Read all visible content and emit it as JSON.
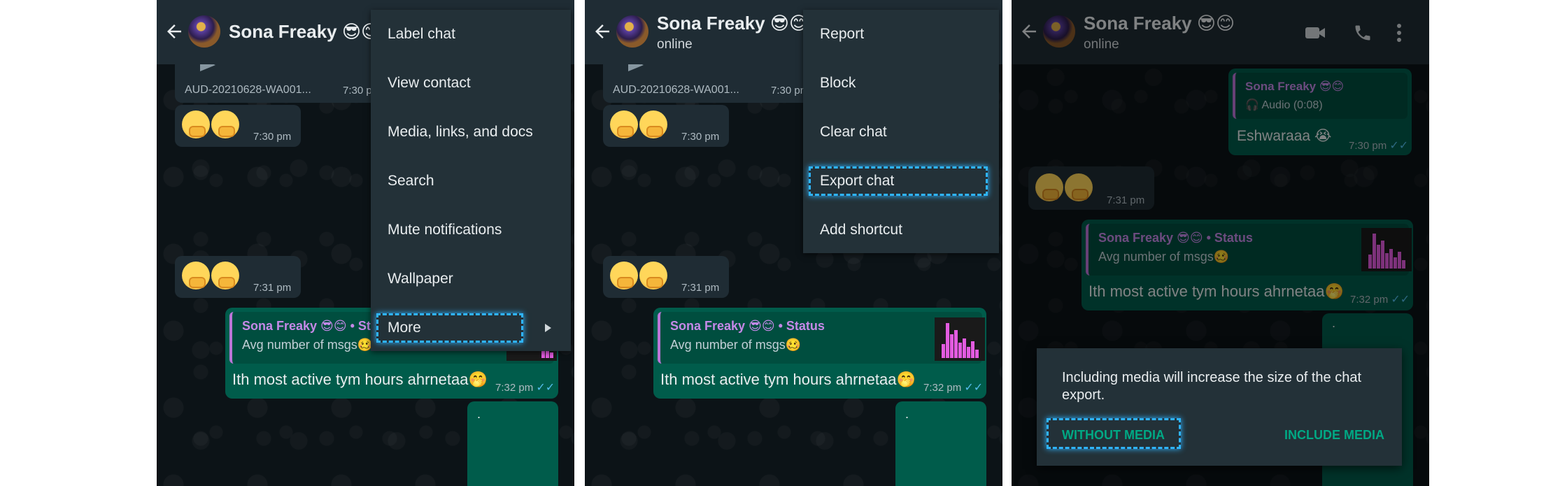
{
  "contact": {
    "name": "Sona Freaky 😎😊",
    "status": "online"
  },
  "messages": {
    "audio_file": "AUD-20210628-WA001...",
    "audio_time": "7:30 pm",
    "emoji1_time": "7:30 pm",
    "emoji2_time": "7:31 pm",
    "status_reply": {
      "name": "Sona Freaky 😎😊",
      "tag": " • Status",
      "sub": "Avg number of msgs🥴",
      "text": "Ith most active tym hours ahrnetaa🤭",
      "time": "7:32 pm"
    },
    "dot": "."
  },
  "panel3": {
    "quote_audio_name": "Sona Freaky 😎😊",
    "quote_audio_sub": "🎧 Audio (0:08)",
    "reply_text": "Eshwaraaa 😭",
    "reply_time": "7:30 pm",
    "emoji_time": "7:31 pm"
  },
  "menu1": {
    "items": [
      "Label chat",
      "View contact",
      "Media, links, and docs",
      "Search",
      "Mute notifications",
      "Wallpaper",
      "More"
    ],
    "highlighted": "More"
  },
  "menu2": {
    "items": [
      "Report",
      "Block",
      "Clear chat",
      "Export chat",
      "Add shortcut"
    ],
    "highlighted": "Export chat"
  },
  "dialog": {
    "text": "Including media will increase the size of the chat export.",
    "without_media": "WITHOUT MEDIA",
    "include_media": "INCLUDE MEDIA"
  },
  "icons": [
    "back-arrow-icon",
    "video-call-icon",
    "phone-icon",
    "more-vert-icon",
    "chevron-right-icon",
    "double-check-icon"
  ],
  "colors": {
    "header": "#1f2c34",
    "outgoing": "#005c4b",
    "incoming": "#1f2c34",
    "accent": "#00a884",
    "highlight": "#2fb4ff"
  }
}
